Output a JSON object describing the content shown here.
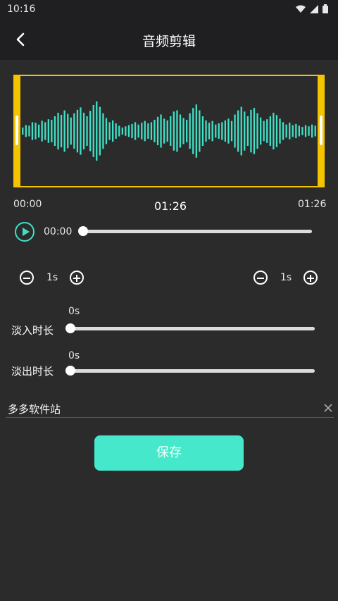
{
  "status": {
    "time": "10:16"
  },
  "header": {
    "title": "音频剪辑"
  },
  "waveform": {
    "bar_color": "#3fe0c5",
    "frame_color": "#f5c400",
    "amplitudes": [
      0.12,
      0.2,
      0.18,
      0.3,
      0.28,
      0.22,
      0.35,
      0.3,
      0.4,
      0.38,
      0.5,
      0.62,
      0.55,
      0.7,
      0.58,
      0.46,
      0.6,
      0.72,
      0.8,
      0.62,
      0.5,
      0.68,
      0.88,
      1.0,
      0.82,
      0.6,
      0.44,
      0.3,
      0.36,
      0.26,
      0.18,
      0.12,
      0.16,
      0.2,
      0.24,
      0.3,
      0.22,
      0.28,
      0.34,
      0.26,
      0.3,
      0.38,
      0.48,
      0.56,
      0.42,
      0.36,
      0.5,
      0.66,
      0.7,
      0.56,
      0.44,
      0.38,
      0.6,
      0.78,
      0.9,
      0.7,
      0.5,
      0.36,
      0.28,
      0.34,
      0.22,
      0.26,
      0.3,
      0.36,
      0.42,
      0.34,
      0.56,
      0.7,
      0.82,
      0.66,
      0.5,
      0.72,
      0.78,
      0.6,
      0.46,
      0.34,
      0.4,
      0.5,
      0.62,
      0.54,
      0.42,
      0.3,
      0.22,
      0.28,
      0.2,
      0.24,
      0.18,
      0.14,
      0.2,
      0.16,
      0.22,
      0.18
    ]
  },
  "timeline": {
    "start": "00:00",
    "total": "01:26",
    "end": "01:26"
  },
  "player": {
    "current": "00:00",
    "progress": 0.0
  },
  "trim": {
    "left_value": "1s",
    "right_value": "1s"
  },
  "fade_in": {
    "label": "淡入时长",
    "value": "0s",
    "progress": 0.0
  },
  "fade_out": {
    "label": "淡出时长",
    "value": "0s",
    "progress": 0.0
  },
  "filename": {
    "value": "多多软件站"
  },
  "actions": {
    "save_label": "保存"
  },
  "colors": {
    "accent": "#45e8cb",
    "background": "#2b2b2b",
    "bar": "#1f1f21"
  }
}
